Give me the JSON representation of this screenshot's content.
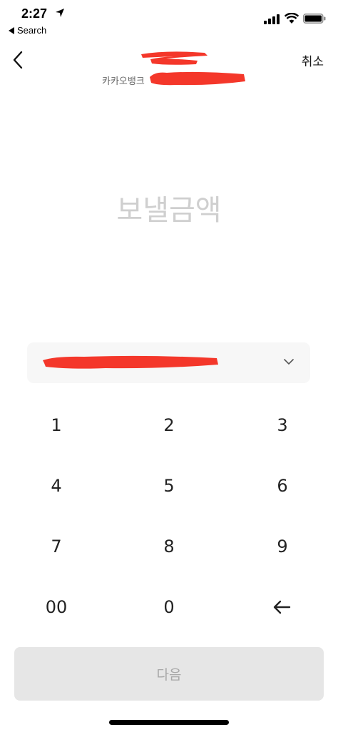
{
  "status_bar": {
    "time": "2:27",
    "back_app": "Search"
  },
  "header": {
    "cancel_label": "취소",
    "recipient_bank": "카카오뱅크"
  },
  "amount": {
    "placeholder": "보낼금액"
  },
  "keypad": {
    "keys": [
      "1",
      "2",
      "3",
      "4",
      "5",
      "6",
      "7",
      "8",
      "9",
      "00",
      "0"
    ],
    "backspace_icon": "backspace-arrow-icon"
  },
  "next_button": {
    "label": "다음"
  },
  "colors": {
    "redaction": "#f4372a",
    "placeholder": "#cfcfcf",
    "disabled_button": "#e6e6e6"
  }
}
